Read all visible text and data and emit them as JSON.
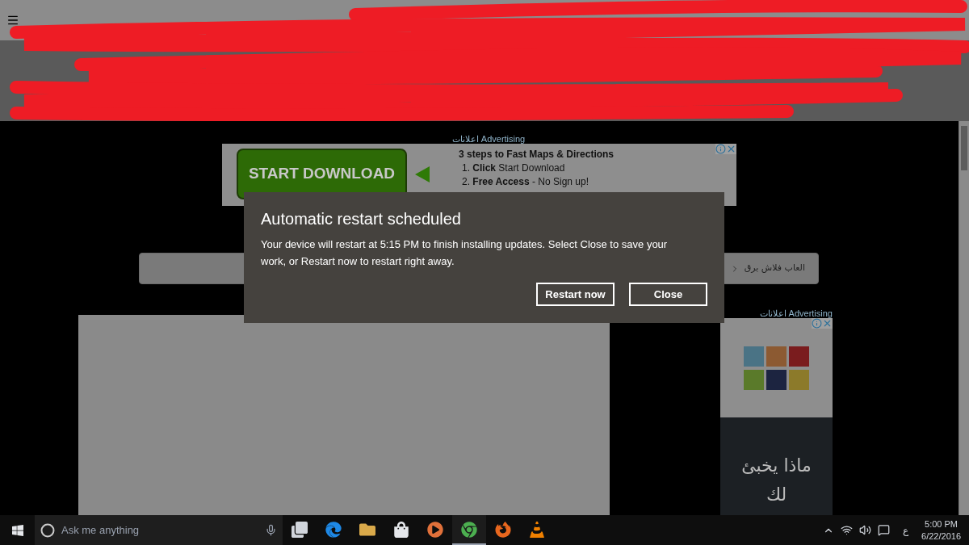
{
  "ad_top": {
    "label": "اعلانات Advertising",
    "button": "START DOWNLOAD",
    "headline": "3 steps to Fast Maps & Directions",
    "steps": [
      "1. **Click** Start Download",
      "2. **Free Access** - No Sign up!"
    ]
  },
  "nav_bar": {
    "text": "العاب فلاش برق"
  },
  "ad_side": {
    "label": "اعلانات Advertising",
    "text": "ماذا يخبئ لك"
  },
  "dialog": {
    "title": "Automatic restart scheduled",
    "message": "Your device will restart at 5:15 PM to finish installing updates. Select Close to save your work, or Restart now to restart right away.",
    "buttons": [
      {
        "label": "Restart now"
      },
      {
        "label": "Close"
      }
    ]
  },
  "taskbar": {
    "search_placeholder": "Ask me anything",
    "apps": [
      {
        "kind": "taskview",
        "selected": false
      },
      {
        "kind": "edge",
        "selected": false
      },
      {
        "kind": "explorer",
        "selected": false
      },
      {
        "kind": "store",
        "selected": false
      },
      {
        "kind": "media",
        "selected": false
      },
      {
        "kind": "chrome",
        "selected": true
      },
      {
        "kind": "firefox",
        "selected": false
      },
      {
        "kind": "vlc",
        "selected": false
      }
    ],
    "language": "ع",
    "time": "5:00 PM",
    "date": "6/22/2016"
  }
}
